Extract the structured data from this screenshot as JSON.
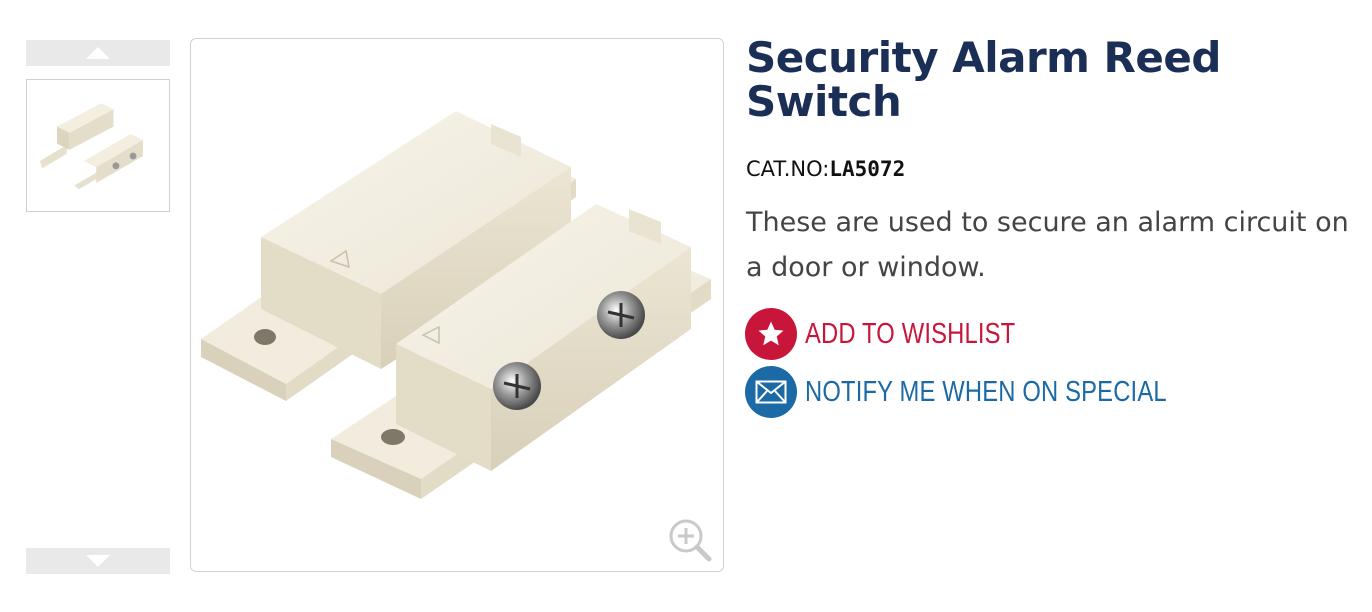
{
  "product": {
    "title": "Security Alarm Reed Switch",
    "cat_label": "CAT.NO:",
    "cat_number": "LA5072",
    "description": "These are used to secure an alarm circuit on a door or window."
  },
  "actions": {
    "wishlist_label": "ADD TO WISHLIST",
    "notify_label": "NOTIFY ME WHEN ON SPECIAL"
  },
  "gallery": {
    "thumbnail_count": 1,
    "icons": [
      "chevron-up-icon",
      "chevron-down-icon",
      "zoom-in-icon"
    ]
  },
  "colors": {
    "title": "#1b2e55",
    "wishlist": "#c8163b",
    "notify": "#1b6aa5"
  }
}
